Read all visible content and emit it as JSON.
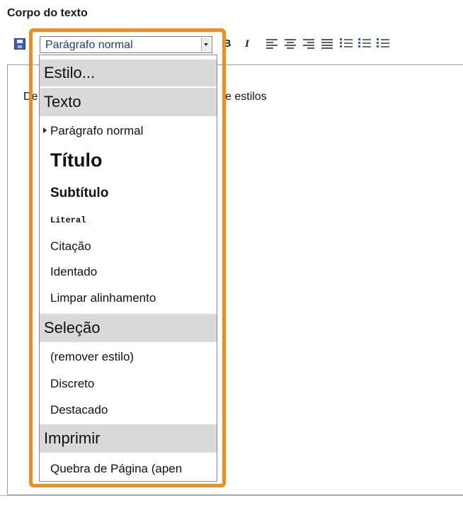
{
  "field_label": "Corpo do texto",
  "toolbar": {
    "style_select_value": "Parágrafo normal",
    "bold_label": "B",
    "italic_label": "I",
    "icons": [
      "save-icon",
      "align-left-icon",
      "align-center-icon",
      "align-right-icon",
      "align-justify-icon",
      "bulleted-list-icon",
      "numbered-list-icon",
      "indent-icon"
    ]
  },
  "editor": {
    "visible_text_left": "De",
    "visible_text_right": "e estilos"
  },
  "dropdown": {
    "header_styles": "Estilo...",
    "section_text": "Texto",
    "items_text": [
      "Parágrafo normal",
      "Título",
      "Subtítulo",
      "Literal",
      "Citação",
      "Identado",
      "Limpar alinhamento"
    ],
    "section_selection": "Seleção",
    "items_selection": [
      "(remover estilo)",
      "Discreto",
      "Destacado"
    ],
    "section_print": "Imprimir",
    "items_print": [
      "Quebra de Página (apen"
    ]
  },
  "colors": {
    "highlight": "#f28c1e",
    "header_bg": "#d9d9d9",
    "select_text": "#1a3a8c"
  }
}
